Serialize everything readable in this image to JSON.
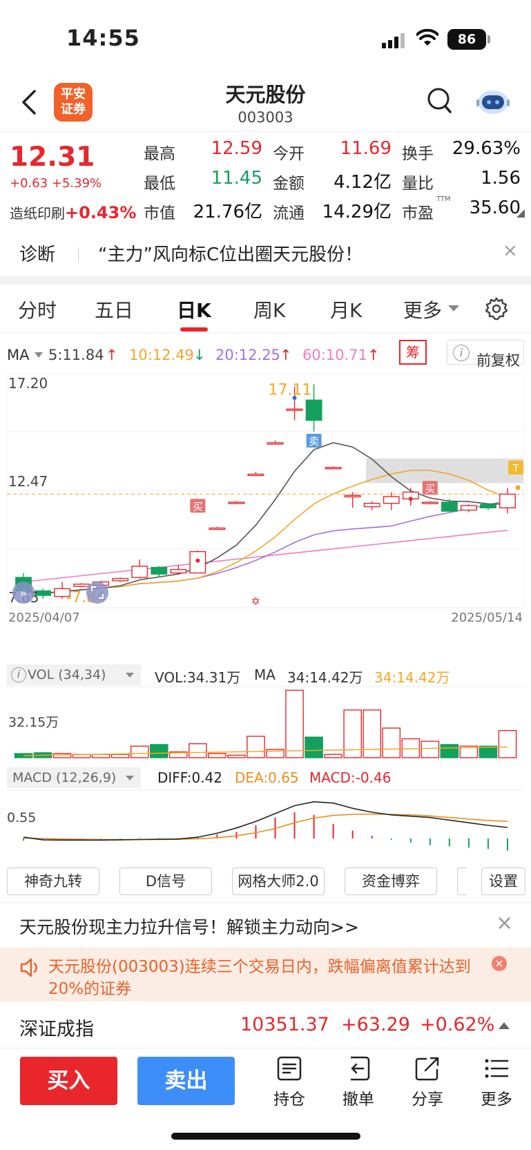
{
  "status": {
    "time": "14:55",
    "battery": "86"
  },
  "header": {
    "logo_line1": "平安",
    "logo_line2": "证券",
    "name": "天元股份",
    "code": "003003"
  },
  "quote": {
    "price": "12.31",
    "change": "+0.63 +5.39%",
    "sector": "造纸印刷",
    "sector_pct": "+0.43%",
    "cells": [
      {
        "label": "最高",
        "value": "12.59",
        "color": "red"
      },
      {
        "label": "今开",
        "value": "11.69",
        "color": "red"
      },
      {
        "label": "换手",
        "value": "29.63%",
        "color": "black"
      },
      {
        "label": "最低",
        "value": "11.45",
        "color": "green"
      },
      {
        "label": "金额",
        "value": "4.12亿",
        "color": "black"
      },
      {
        "label": "量比",
        "value": "1.56",
        "color": "black"
      },
      {
        "label": "市值",
        "value": "21.76亿",
        "color": "black"
      },
      {
        "label": "流通",
        "value": "14.29亿",
        "color": "black"
      },
      {
        "label": "市盈",
        "value": "35.60",
        "color": "black"
      }
    ],
    "ttm": "TTM"
  },
  "diagnosis": {
    "label": "诊断",
    "text": "“主力”风向标C位出圈天元股份！",
    "close": "×"
  },
  "tabs": [
    "分时",
    "五日",
    "日K",
    "周K",
    "月K",
    "更多"
  ],
  "ma_row": {
    "label": "MA",
    "ma5": "5:11.84",
    "ma10": "10:12.49",
    "ma20": "20:12.25",
    "ma60": "60:10.71",
    "chip": "筹",
    "adjust": "前复权"
  },
  "colors": {
    "up": "#e8262b",
    "down": "#13a05c",
    "ma5": "#555555",
    "ma10": "#f5a623",
    "ma20": "#a46ee0",
    "ma60": "#f07cbf"
  },
  "chart_data": {
    "type": "candlestick",
    "date_start": "2025/04/07",
    "date_end": "2025/05/14",
    "y_labels": [
      "17.20",
      "12.47",
      "7.65"
    ],
    "high_label": "17.11",
    "low_label": "7.84",
    "buy_label": "买",
    "sell_label": "卖",
    "t_label": "T",
    "candles": [
      {
        "o": 8.6,
        "h": 8.8,
        "l": 7.9,
        "c": 8.0
      },
      {
        "o": 8.0,
        "h": 8.1,
        "l": 7.65,
        "c": 7.8
      },
      {
        "o": 7.75,
        "h": 8.4,
        "l": 7.65,
        "c": 8.1
      },
      {
        "o": 8.2,
        "h": 8.35,
        "l": 8.15,
        "c": 8.3
      },
      {
        "o": 8.25,
        "h": 8.45,
        "l": 8.25,
        "c": 8.4
      },
      {
        "o": 8.45,
        "h": 8.6,
        "l": 8.4,
        "c": 8.55
      },
      {
        "o": 8.6,
        "h": 9.4,
        "l": 8.55,
        "c": 9.1
      },
      {
        "o": 9.05,
        "h": 9.1,
        "l": 8.6,
        "c": 8.75
      },
      {
        "o": 8.8,
        "h": 9.15,
        "l": 8.75,
        "c": 8.95
      },
      {
        "o": 8.8,
        "h": 9.8,
        "l": 8.8,
        "c": 9.75
      },
      {
        "o": 10.8,
        "h": 10.85,
        "l": 10.75,
        "c": 10.8
      },
      {
        "o": 11.95,
        "h": 12.0,
        "l": 11.9,
        "c": 11.95
      },
      {
        "o": 13.2,
        "h": 13.3,
        "l": 13.15,
        "c": 13.2
      },
      {
        "o": 14.6,
        "h": 14.7,
        "l": 14.55,
        "c": 14.6
      },
      {
        "o": 16.1,
        "h": 17.11,
        "l": 15.6,
        "c": 16.1
      },
      {
        "o": 16.5,
        "h": 17.2,
        "l": 15.1,
        "c": 15.6
      },
      {
        "o": 13.5,
        "h": 13.55,
        "l": 13.45,
        "c": 13.5
      },
      {
        "o": 12.25,
        "h": 12.4,
        "l": 11.7,
        "c": 12.25
      },
      {
        "o": 11.75,
        "h": 12.0,
        "l": 11.6,
        "c": 11.9
      },
      {
        "o": 11.9,
        "h": 12.4,
        "l": 11.6,
        "c": 12.2
      },
      {
        "o": 12.1,
        "h": 12.6,
        "l": 11.8,
        "c": 12.4
      },
      {
        "o": 11.95,
        "h": 12.0,
        "l": 11.9,
        "c": 11.95
      },
      {
        "o": 11.95,
        "h": 12.1,
        "l": 11.55,
        "c": 11.55
      },
      {
        "o": 11.6,
        "h": 11.85,
        "l": 11.5,
        "c": 11.8
      },
      {
        "o": 11.85,
        "h": 11.9,
        "l": 11.6,
        "c": 11.7
      },
      {
        "o": 11.7,
        "h": 12.59,
        "l": 11.45,
        "c": 12.31
      }
    ]
  },
  "vol": {
    "selector": "VOL (34,34)",
    "vol_text": "VOL:34.31万",
    "ma_label": "MA",
    "ma1": "34:14.42万",
    "ma2": "34:14.42万",
    "axis_label": "32.15万",
    "bars": [
      2.5,
      3,
      2.5,
      2,
      2,
      2,
      7,
      8,
      3.5,
      8.5,
      2.5,
      1.5,
      13,
      5,
      41,
      12.5,
      2,
      29,
      29,
      18,
      11.5,
      10,
      8,
      7,
      7,
      16.5
    ]
  },
  "macd": {
    "selector": "MACD (12,26,9)",
    "diff": "DIFF:0.42",
    "dea": "DEA:0.65",
    "macd": "MACD:-0.46",
    "axis_label": "0.55",
    "hist": [
      -0.08,
      -0.04,
      -0.03,
      -0.03,
      -0.03,
      -0.02,
      0.02,
      0.01,
      0.01,
      0.05,
      0.15,
      0.25,
      0.5,
      0.8,
      1.0,
      0.9,
      0.55,
      0.3,
      0.1,
      -0.05,
      -0.15,
      -0.25,
      -0.3,
      -0.35,
      -0.4,
      -0.46
    ]
  },
  "indicators": [
    "神奇九转",
    "D信号",
    "网格大师2.0",
    "资金博弈",
    "设置"
  ],
  "banner": {
    "text": "天元股份现主力拉升信号！解锁主力动向>>",
    "close": "×"
  },
  "warning": {
    "text": "天元股份(003003)连续三个交易日内，跌幅偏离值累计达到20%的证券",
    "close": "×"
  },
  "index": {
    "name": "深证成指",
    "value": "10351.37",
    "change": "+63.29",
    "pct": "+0.62%"
  },
  "bottom": {
    "buy": "买入",
    "sell": "卖出",
    "hold": "持仓",
    "cancel": "撤单",
    "share": "分享",
    "more": "更多"
  }
}
